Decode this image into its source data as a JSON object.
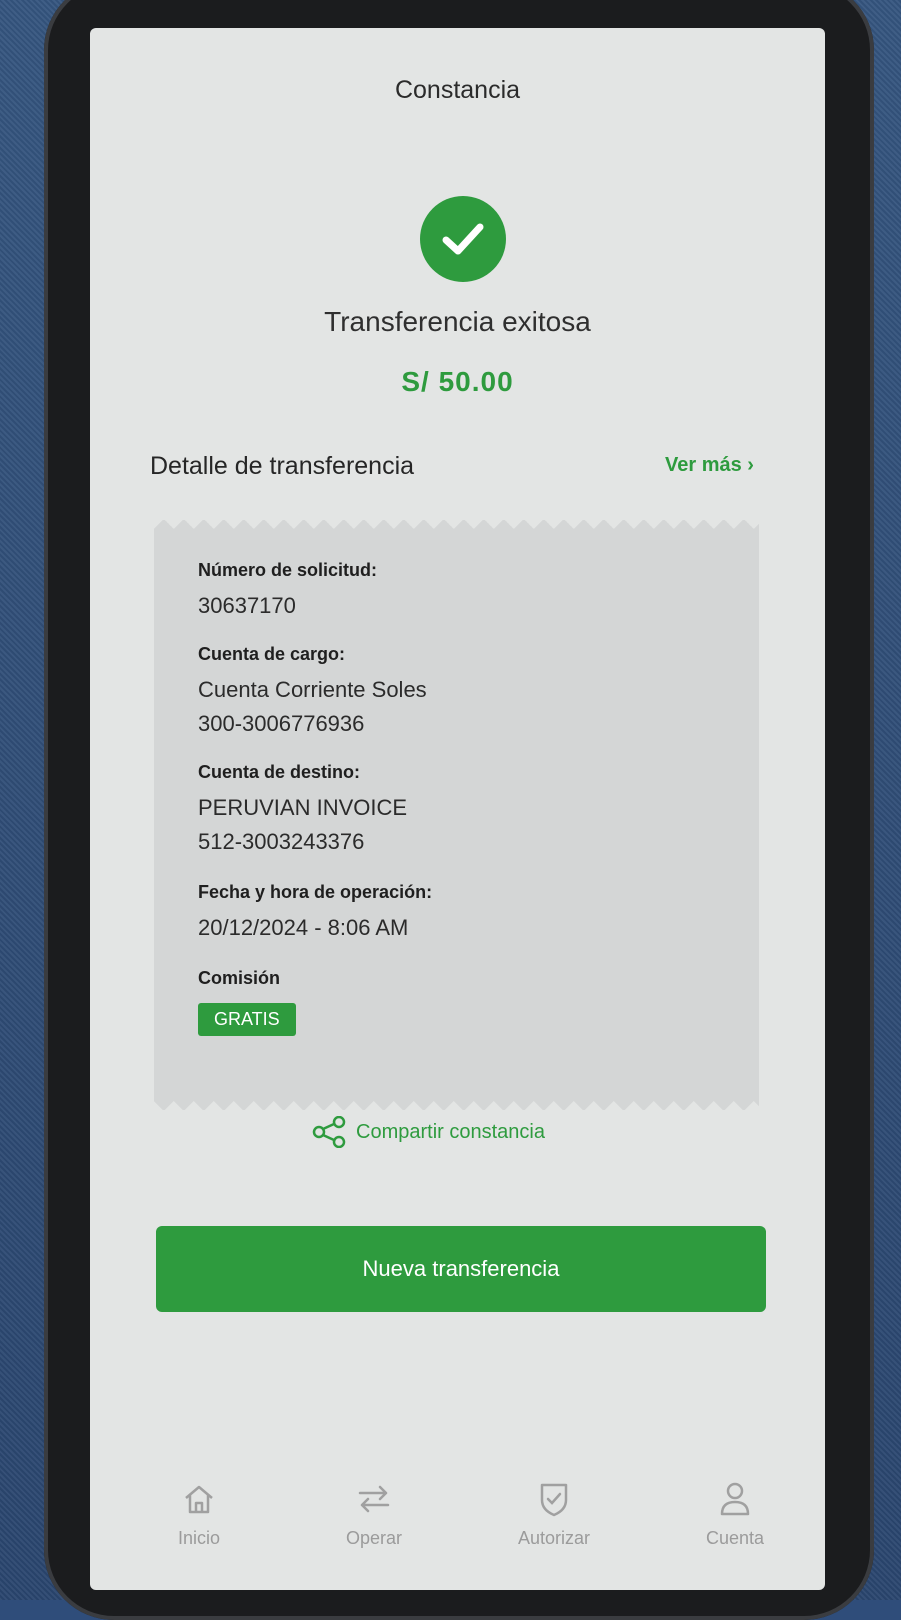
{
  "header": {
    "title": "Constancia"
  },
  "result": {
    "status_text": "Transferencia exitosa",
    "amount": "S/ 50.00",
    "icon": "check-circle-icon",
    "accent_color": "#2e9b3e"
  },
  "detail": {
    "title": "Detalle de transferencia",
    "ver_mas": "Ver más",
    "fields": [
      {
        "label": "Número de solicitud:",
        "values": [
          "30637170"
        ]
      },
      {
        "label": "Cuenta de cargo:",
        "values": [
          "Cuenta Corriente Soles",
          "300-3006776936"
        ]
      },
      {
        "label": "Cuenta de destino:",
        "values": [
          "PERUVIAN INVOICE",
          "512-3003243376"
        ]
      },
      {
        "label": "Fecha y hora de operación:",
        "values": [
          "20/12/2024 - 8:06 AM"
        ]
      },
      {
        "label": "Comisión",
        "badge": "GRATIS"
      }
    ]
  },
  "actions": {
    "share_label": "Compartir constancia",
    "primary_button": "Nueva transferencia"
  },
  "tabbar": {
    "items": [
      {
        "label": "Inicio",
        "icon": "home-icon"
      },
      {
        "label": "Operar",
        "icon": "swap-arrows-icon"
      },
      {
        "label": "Autorizar",
        "icon": "shield-check-icon"
      },
      {
        "label": "Cuenta",
        "icon": "user-icon"
      }
    ]
  }
}
